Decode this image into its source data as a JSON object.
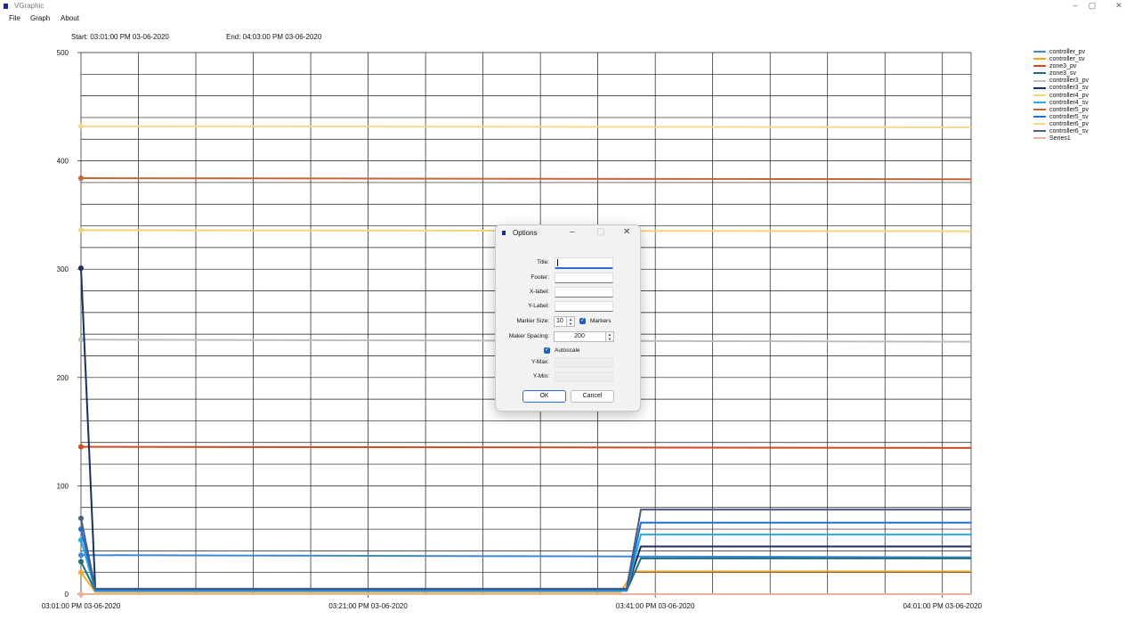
{
  "window": {
    "title": "VGraphic",
    "controls": {
      "minimize": "–",
      "maximize": "▢",
      "close": "✕"
    }
  },
  "menu": [
    "File",
    "Graph",
    "About"
  ],
  "range": {
    "start": "Start: 03:01:00 PM 03-06-2020",
    "end": "End: 04:03:00 PM 03-06-2020"
  },
  "chart_data": {
    "type": "line",
    "ylim": [
      0,
      500
    ],
    "y_ticks": [
      "0",
      "100",
      "200",
      "300",
      "400",
      "500"
    ],
    "x_ticks": [
      "03:01:00 PM 03-06-2020",
      "03:21:00 PM 03-06-2020",
      "03:41:00 PM 03-06-2020",
      "04:01:00 PM 03-06-2020"
    ],
    "x_minutes": [
      0,
      62
    ],
    "grid": true,
    "legend_position": "top-right",
    "series": [
      {
        "name": "controller_pv",
        "color": "#3f86d6",
        "points": [
          [
            0,
            36
          ],
          [
            62,
            34
          ]
        ]
      },
      {
        "name": "controller_sv",
        "color": "#f0a830",
        "points": [
          [
            0,
            20
          ],
          [
            1,
            2
          ],
          [
            37.6,
            2
          ],
          [
            38.5,
            21
          ],
          [
            62,
            21
          ]
        ]
      },
      {
        "name": "zone3_pv",
        "color": "#d04a1f",
        "points": [
          [
            0,
            136
          ],
          [
            62,
            135
          ]
        ]
      },
      {
        "name": "zone3_sv",
        "color": "#1f6f7a",
        "points": [
          [
            0,
            30
          ],
          [
            1,
            3
          ],
          [
            38,
            3
          ],
          [
            39,
            33
          ],
          [
            62,
            33
          ]
        ]
      },
      {
        "name": "controller3_pv",
        "color": "#bdbdbd",
        "points": [
          [
            0,
            235
          ],
          [
            62,
            233
          ]
        ]
      },
      {
        "name": "controller3_sv",
        "color": "#1a2f5e",
        "points": [
          [
            0,
            301
          ],
          [
            1,
            4
          ],
          [
            38,
            4
          ],
          [
            39,
            44
          ],
          [
            62,
            44
          ]
        ]
      },
      {
        "name": "controller4_pv",
        "color": "#f2d47a",
        "points": [
          [
            0,
            336
          ],
          [
            62,
            335
          ]
        ]
      },
      {
        "name": "controller4_sv",
        "color": "#2aa9e0",
        "points": [
          [
            0,
            50
          ],
          [
            1,
            3
          ],
          [
            38,
            3
          ],
          [
            39,
            55
          ],
          [
            62,
            55
          ]
        ]
      },
      {
        "name": "controller5_pv",
        "color": "#c8633a",
        "points": [
          [
            0,
            384
          ],
          [
            62,
            383
          ]
        ]
      },
      {
        "name": "controller5_sv",
        "color": "#1f6fd6",
        "points": [
          [
            0,
            60
          ],
          [
            1,
            4
          ],
          [
            38,
            4
          ],
          [
            39,
            66
          ],
          [
            62,
            66
          ]
        ]
      },
      {
        "name": "controller6_pv",
        "color": "#f5d98c",
        "points": [
          [
            0,
            432
          ],
          [
            62,
            431
          ]
        ]
      },
      {
        "name": "controller6_sv",
        "color": "#4b5d80",
        "points": [
          [
            0,
            70
          ],
          [
            1,
            5
          ],
          [
            38,
            5
          ],
          [
            39,
            78
          ],
          [
            62,
            78
          ]
        ]
      },
      {
        "name": "Series1",
        "color": "#e8b4a0",
        "points": [
          [
            0,
            0
          ],
          [
            62,
            0
          ]
        ]
      }
    ]
  },
  "dialog": {
    "title": "Options",
    "controls": {
      "minimize": "–",
      "maximize": "▢",
      "close": "✕"
    },
    "labels": {
      "title": "Title:",
      "footer": "Footer:",
      "xlabel": "X-label:",
      "ylabel": "Y-Label:",
      "marker_size": "Marker Size:",
      "marker_spacing": "Maker Spacing:",
      "ymax": "Y-Max:",
      "ymin": "Y-Min:"
    },
    "values": {
      "title": "",
      "footer": "",
      "xlabel": "",
      "ylabel": "",
      "marker_size": "10",
      "marker_spacing": "200"
    },
    "markers_label": "Markers",
    "markers_checked": true,
    "autoscale_label": "Autoscale",
    "autoscale_checked": true,
    "ok": "OK",
    "cancel": "Cancel"
  }
}
